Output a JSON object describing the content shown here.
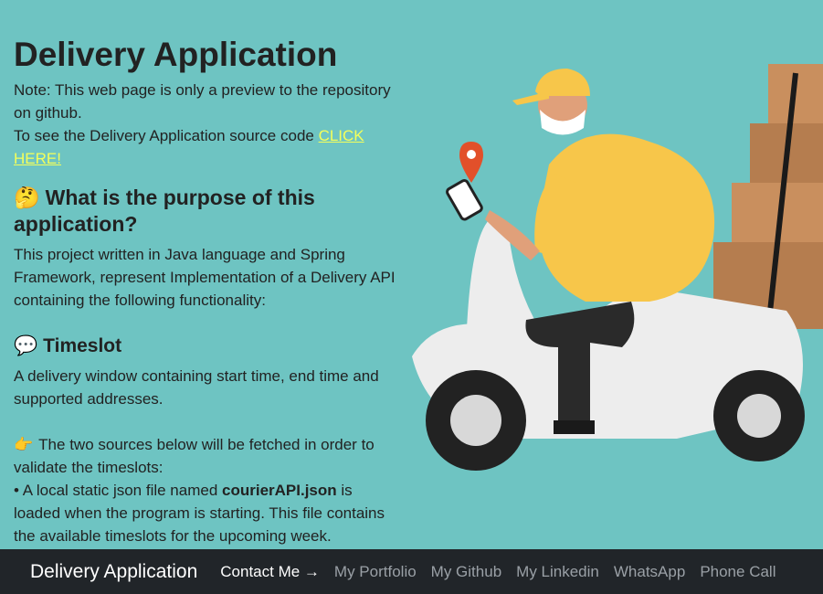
{
  "page": {
    "title": "Delivery Application",
    "note_line1": "Note: This web page is only a preview to the repository on github.",
    "note_line2": "To see the Delivery Application source code ",
    "click_here": "CLICK HERE!",
    "purpose_emoji": "🤔",
    "purpose_heading": "What is the purpose of this application?",
    "purpose_text": "This project written in Java language and Spring Framework, represent Implementation of a Delivery API containing the following functionality:",
    "timeslot_emoji": "💬",
    "timeslot_heading": "Timeslot",
    "timeslot_text": "A delivery window containing start time, end time and supported addresses.",
    "sources_emoji": "👉",
    "sources_text": "The two sources below will be fetched in order to validate the timeslots:",
    "bullet_prefix": "• A local static json file named ",
    "bullet_bold": "courierAPI.json",
    "bullet_suffix": " is loaded when the program is starting. This file contains the available timeslots for the upcoming week."
  },
  "navbar": {
    "brand": "Delivery Application",
    "links": [
      "Contact Me →",
      "My Portfolio",
      "My Github",
      "My Linkedin",
      "WhatsApp",
      "Phone Call"
    ]
  },
  "colors": {
    "background": "#6ec4c2",
    "link": "#f4ff5a",
    "navbar": "#212529"
  },
  "icons": [
    "thinking-face-icon",
    "speech-bubble-icon",
    "pointing-hand-icon",
    "location-pin-icon"
  ]
}
